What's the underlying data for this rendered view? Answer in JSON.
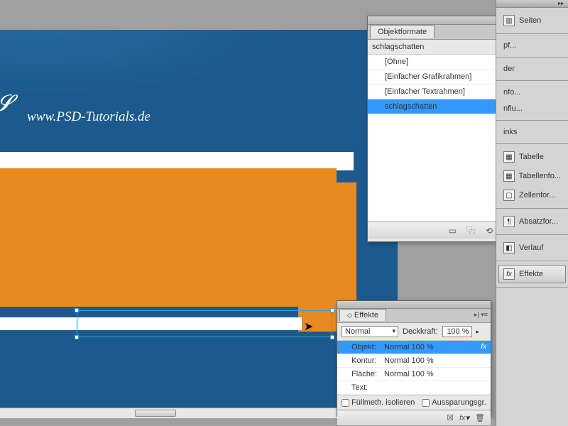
{
  "canvas": {
    "url": "www.PSD-Tutorials.de"
  },
  "objektformate": {
    "tab": "Objektformate",
    "filter": "schlagschatten",
    "items": [
      {
        "label": "[Ohne]",
        "icon": "╳",
        "red": true
      },
      {
        "label": "[Einfacher Grafikrahmen]",
        "icon": "⊠"
      },
      {
        "label": "[Einfacher Textrahmen]",
        "icon": "T"
      },
      {
        "label": "schlagschatten",
        "icon": "",
        "sel": true
      }
    ]
  },
  "effekte": {
    "tab": "Effekte",
    "blend": "Normal",
    "opLabel": "Deckkraft:",
    "opVal": "100 %",
    "rows": [
      {
        "label": "Objekt:",
        "val": "Normal 100 %",
        "sel": true,
        "fx": true,
        "arr": true
      },
      {
        "label": "Kontur:",
        "val": "Normal 100 %"
      },
      {
        "label": "Fläche:",
        "val": "Normal 100 %"
      },
      {
        "label": "Text:",
        "val": "",
        "dim": true
      }
    ],
    "chk1": "Füllmeth. isolieren",
    "chk2": "Aussparungsgr."
  },
  "dock": {
    "items": [
      {
        "label": "Seiten",
        "icon": "▥"
      },
      {
        "label": "pf..."
      },
      {
        "label": "der"
      },
      {
        "label": "nfo..."
      },
      {
        "label": "nflu..."
      },
      {
        "label": "inks"
      },
      {
        "label": "Tabelle",
        "icon": "▦"
      },
      {
        "label": "Tabellenfo...",
        "icon": "▦"
      },
      {
        "label": "Zellenfor...",
        "icon": "▢"
      },
      {
        "label": "Absatzfor...",
        "icon": "¶"
      },
      {
        "label": "Verlauf",
        "icon": "◧"
      },
      {
        "label": "Effekte",
        "icon": "fx",
        "act": true
      }
    ]
  }
}
